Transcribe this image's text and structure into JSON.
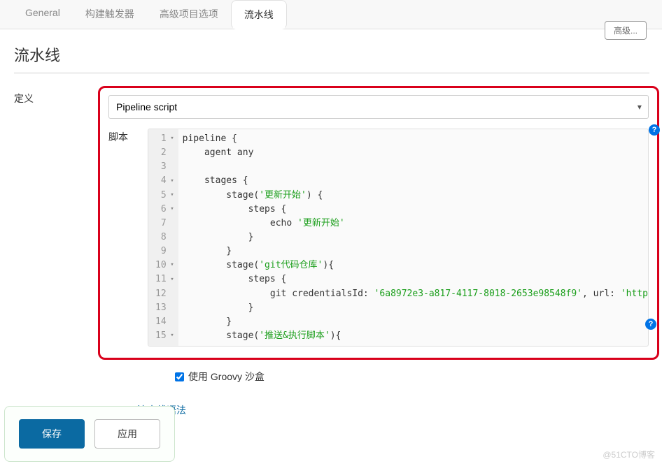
{
  "tabs": [
    {
      "label": "General"
    },
    {
      "label": "构建触发器"
    },
    {
      "label": "高级项目选项"
    },
    {
      "label": "流水线"
    }
  ],
  "top_button": "高级...",
  "section": {
    "title": "流水线",
    "definition_label": "定义",
    "definition_select": "Pipeline script",
    "script_label": "脚本"
  },
  "code": {
    "lines": [
      {
        "n": 1,
        "fold": true,
        "indent": 0,
        "pre": "pipeline {",
        "str": "",
        "post": ""
      },
      {
        "n": 2,
        "fold": false,
        "indent": 1,
        "pre": "agent any",
        "str": "",
        "post": ""
      },
      {
        "n": 3,
        "fold": false,
        "indent": 0,
        "pre": "",
        "str": "",
        "post": ""
      },
      {
        "n": 4,
        "fold": true,
        "indent": 1,
        "pre": "stages {",
        "str": "",
        "post": ""
      },
      {
        "n": 5,
        "fold": true,
        "indent": 2,
        "pre": "stage(",
        "str": "'更新开始'",
        "post": ") {"
      },
      {
        "n": 6,
        "fold": true,
        "indent": 3,
        "pre": "steps {",
        "str": "",
        "post": ""
      },
      {
        "n": 7,
        "fold": false,
        "indent": 4,
        "pre": "echo ",
        "str": "'更新开始'",
        "post": ""
      },
      {
        "n": 8,
        "fold": false,
        "indent": 3,
        "pre": "}",
        "str": "",
        "post": ""
      },
      {
        "n": 9,
        "fold": false,
        "indent": 2,
        "pre": "}",
        "str": "",
        "post": ""
      },
      {
        "n": 10,
        "fold": true,
        "indent": 2,
        "pre": "stage(",
        "str": "'git代码仓库'",
        "post": "){"
      },
      {
        "n": 11,
        "fold": true,
        "indent": 3,
        "pre": "steps {",
        "str": "",
        "post": ""
      },
      {
        "n": 12,
        "fold": false,
        "indent": 4,
        "pre": "git credentialsId: ",
        "str": "'6a8972e3-a817-4117-8018-2653e98548f9'",
        "post": ", url: ",
        "str2": "'http"
      },
      {
        "n": 13,
        "fold": false,
        "indent": 3,
        "pre": "}",
        "str": "",
        "post": ""
      },
      {
        "n": 14,
        "fold": false,
        "indent": 2,
        "pre": "}",
        "str": "",
        "post": ""
      },
      {
        "n": 15,
        "fold": true,
        "indent": 2,
        "pre": "stage(",
        "str": "'推送&执行脚本'",
        "post": "){"
      }
    ]
  },
  "checkbox": {
    "label": "使用 Groovy 沙盒",
    "checked": true
  },
  "link": "流水线语法",
  "buttons": {
    "save": "保存",
    "apply": "应用"
  },
  "help_icon": "?",
  "watermark": "@51CTO博客"
}
